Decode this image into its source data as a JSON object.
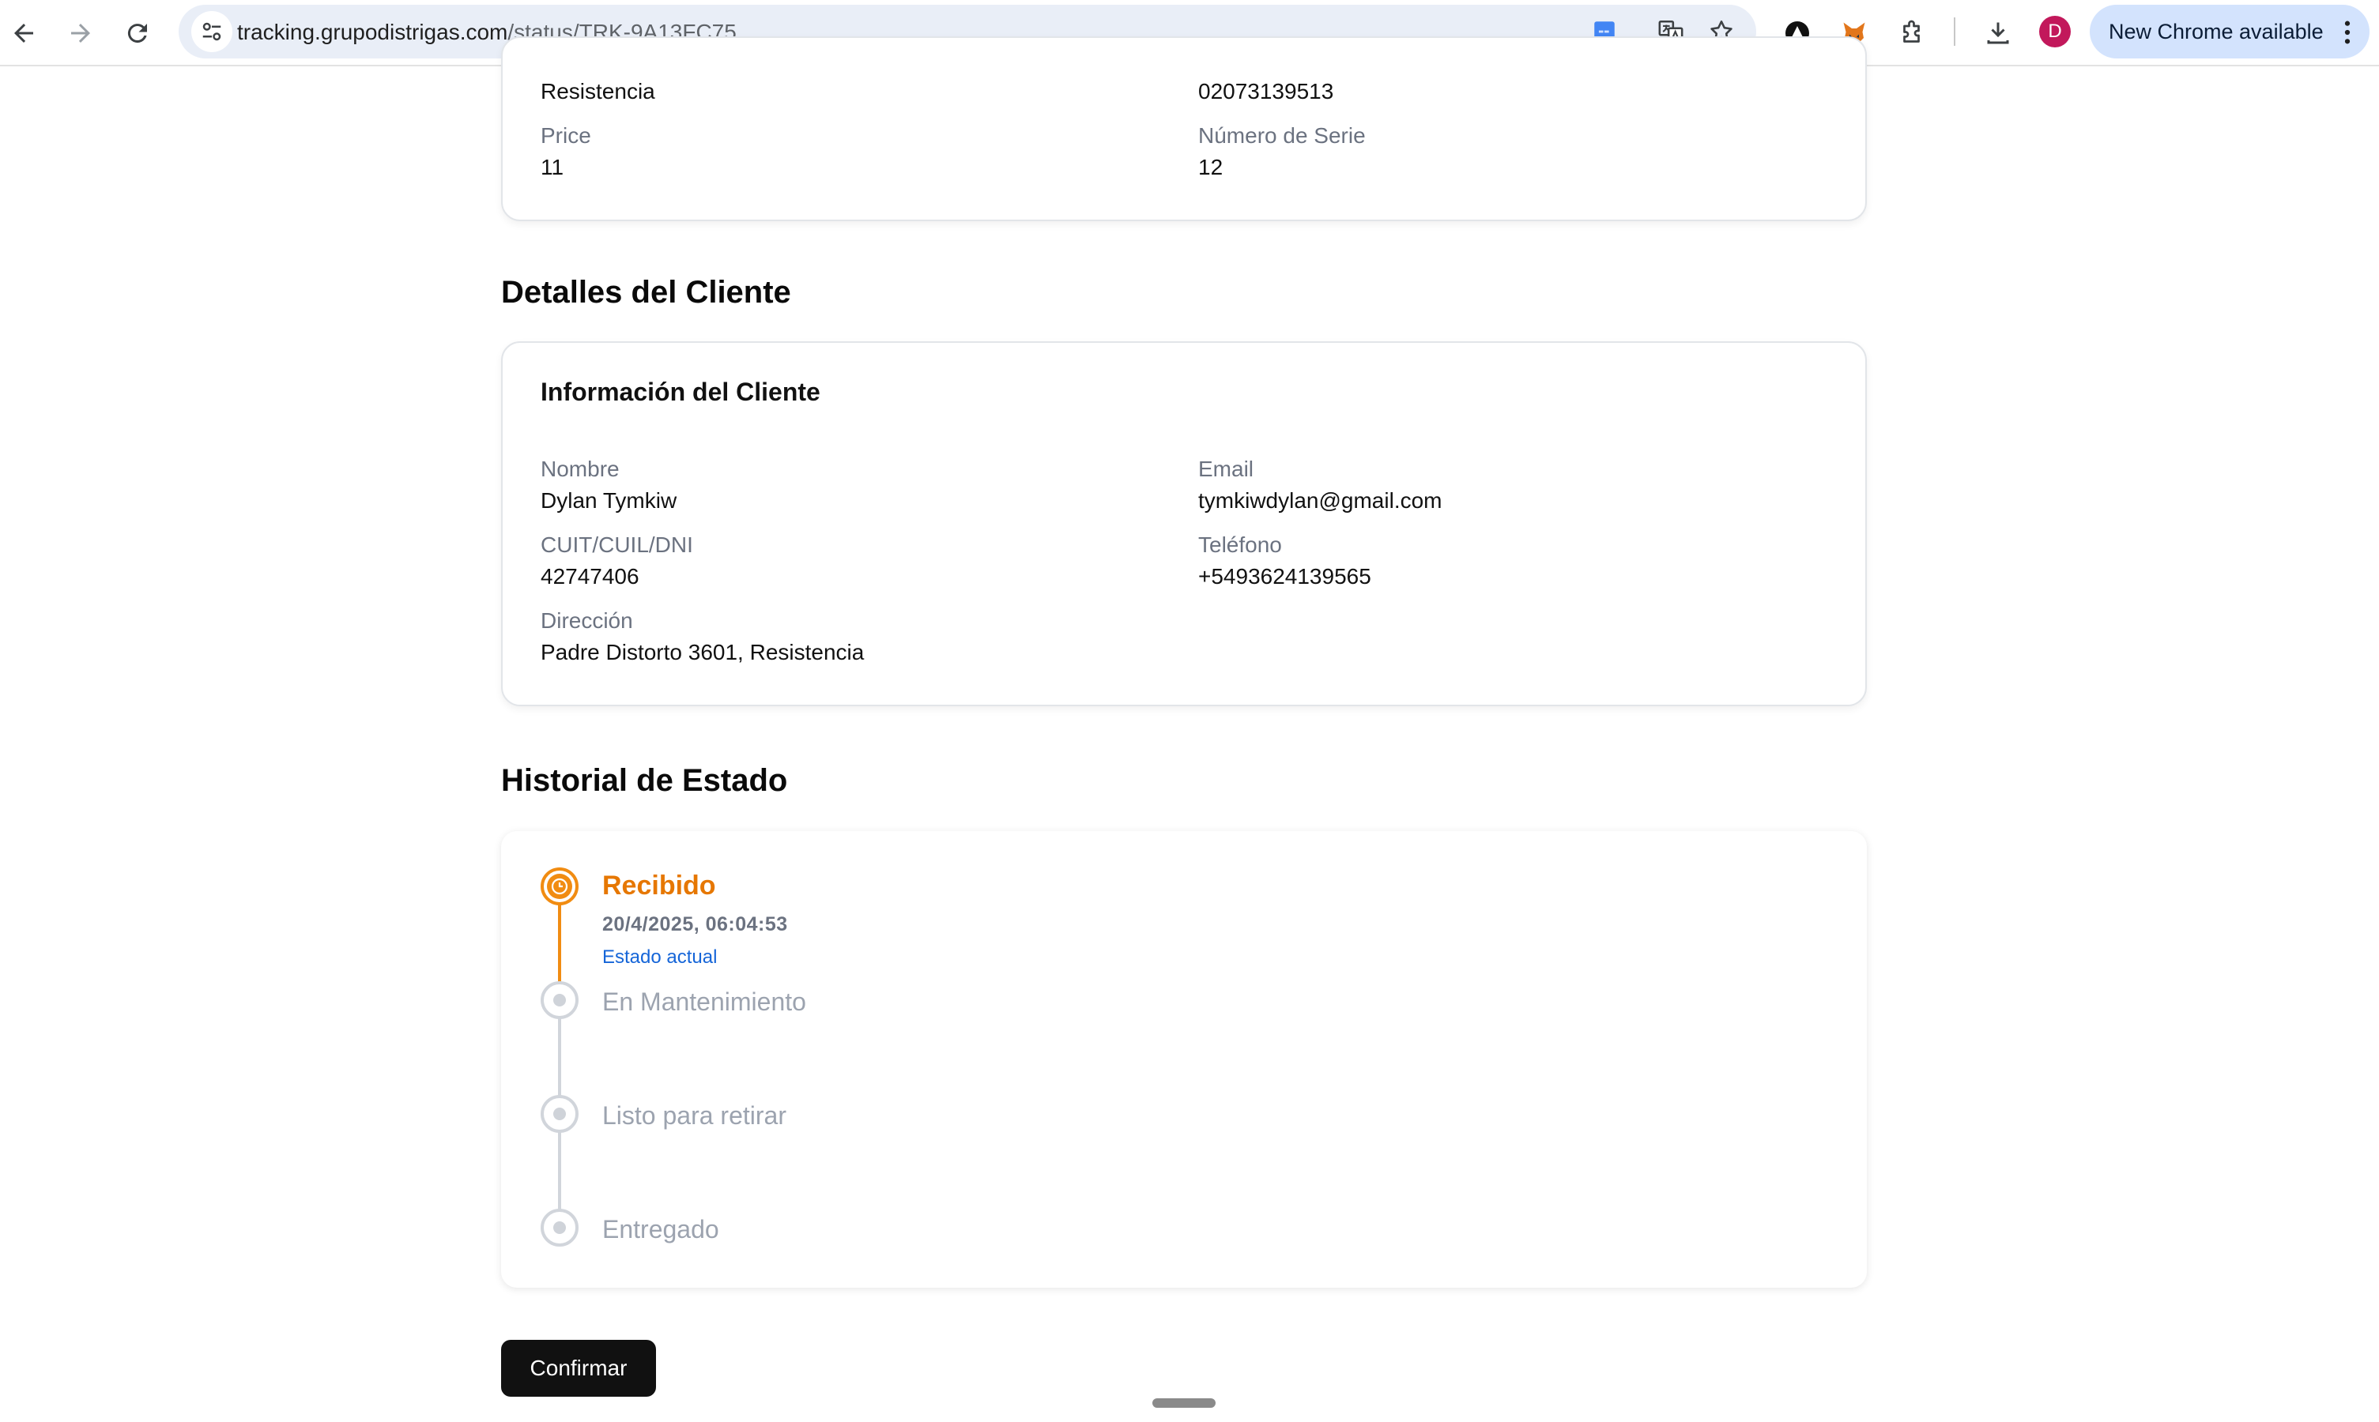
{
  "browser": {
    "url_domain": "tracking.grupodistrigas.com",
    "url_path": "/status/TRK-9A13FC75",
    "profile_initial": "D",
    "update_label": "New Chrome available"
  },
  "product": {
    "fields": [
      {
        "label": "",
        "value": "Resistencia"
      },
      {
        "label": "",
        "value": "02073139513"
      },
      {
        "label": "Price",
        "value": "11"
      },
      {
        "label": "Número de Serie",
        "value": "12"
      }
    ]
  },
  "client": {
    "section_title": "Detalles del Cliente",
    "card_title": "Información del Cliente",
    "nombre_label": "Nombre",
    "nombre_value": "Dylan Tymkiw",
    "email_label": "Email",
    "email_value": "tymkiwdylan@gmail.com",
    "doc_label": "CUIT/CUIL/DNI",
    "doc_value": "42747406",
    "phone_label": "Teléfono",
    "phone_value": "+5493624139565",
    "address_label": "Dirección",
    "address_value": "Padre Distorto 3601, Resistencia"
  },
  "history": {
    "section_title": "Historial de Estado",
    "steps": [
      {
        "title": "Recibido",
        "date": "20/4/2025, 06:04:53",
        "note": "Estado actual",
        "state": "active"
      },
      {
        "title": "En Mantenimiento",
        "state": "pending"
      },
      {
        "title": "Listo para retirar",
        "state": "pending"
      },
      {
        "title": "Entregado",
        "state": "pending"
      }
    ]
  },
  "actions": {
    "confirm_label": "Confirmar"
  },
  "colors": {
    "active": "#f18c12",
    "active_text": "#e67700",
    "link": "#1565d8",
    "pending": "#d1d5db",
    "button": "#111111"
  }
}
